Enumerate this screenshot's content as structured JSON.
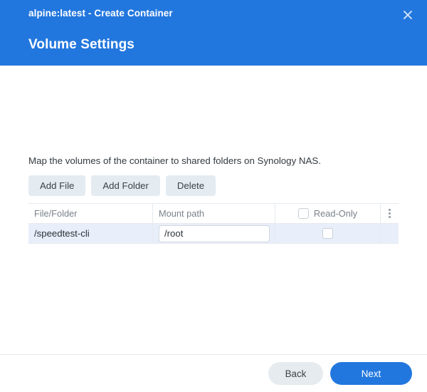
{
  "window": {
    "title": "alpine:latest - Create Container",
    "close_icon": "close-icon",
    "step_title": "Volume Settings"
  },
  "main": {
    "description": "Map the volumes of the container to shared folders on Synology NAS.",
    "toolbar": {
      "add_file_label": "Add File",
      "add_folder_label": "Add Folder",
      "delete_label": "Delete"
    },
    "table": {
      "columns": [
        {
          "key": "file",
          "label": "File/Folder"
        },
        {
          "key": "mount",
          "label": "Mount path"
        },
        {
          "key": "readonly",
          "label": "Read-Only"
        },
        {
          "key": "menu",
          "label": ""
        }
      ],
      "header_readonly_checked": false,
      "menu_icon": "more-vertical-icon",
      "rows": [
        {
          "file": "/speedtest-cli",
          "mount_value": "/root",
          "mount_placeholder": "",
          "readonly_checked": false,
          "selected": true
        }
      ]
    }
  },
  "footer": {
    "back_label": "Back",
    "next_label": "Next"
  },
  "colors": {
    "accent": "#2277de",
    "toolbar_button": "#e4ebf1",
    "row_selected": "#e8eefa",
    "border": "#e6eaef",
    "text": "#32373c",
    "muted_text": "#7a828a"
  }
}
